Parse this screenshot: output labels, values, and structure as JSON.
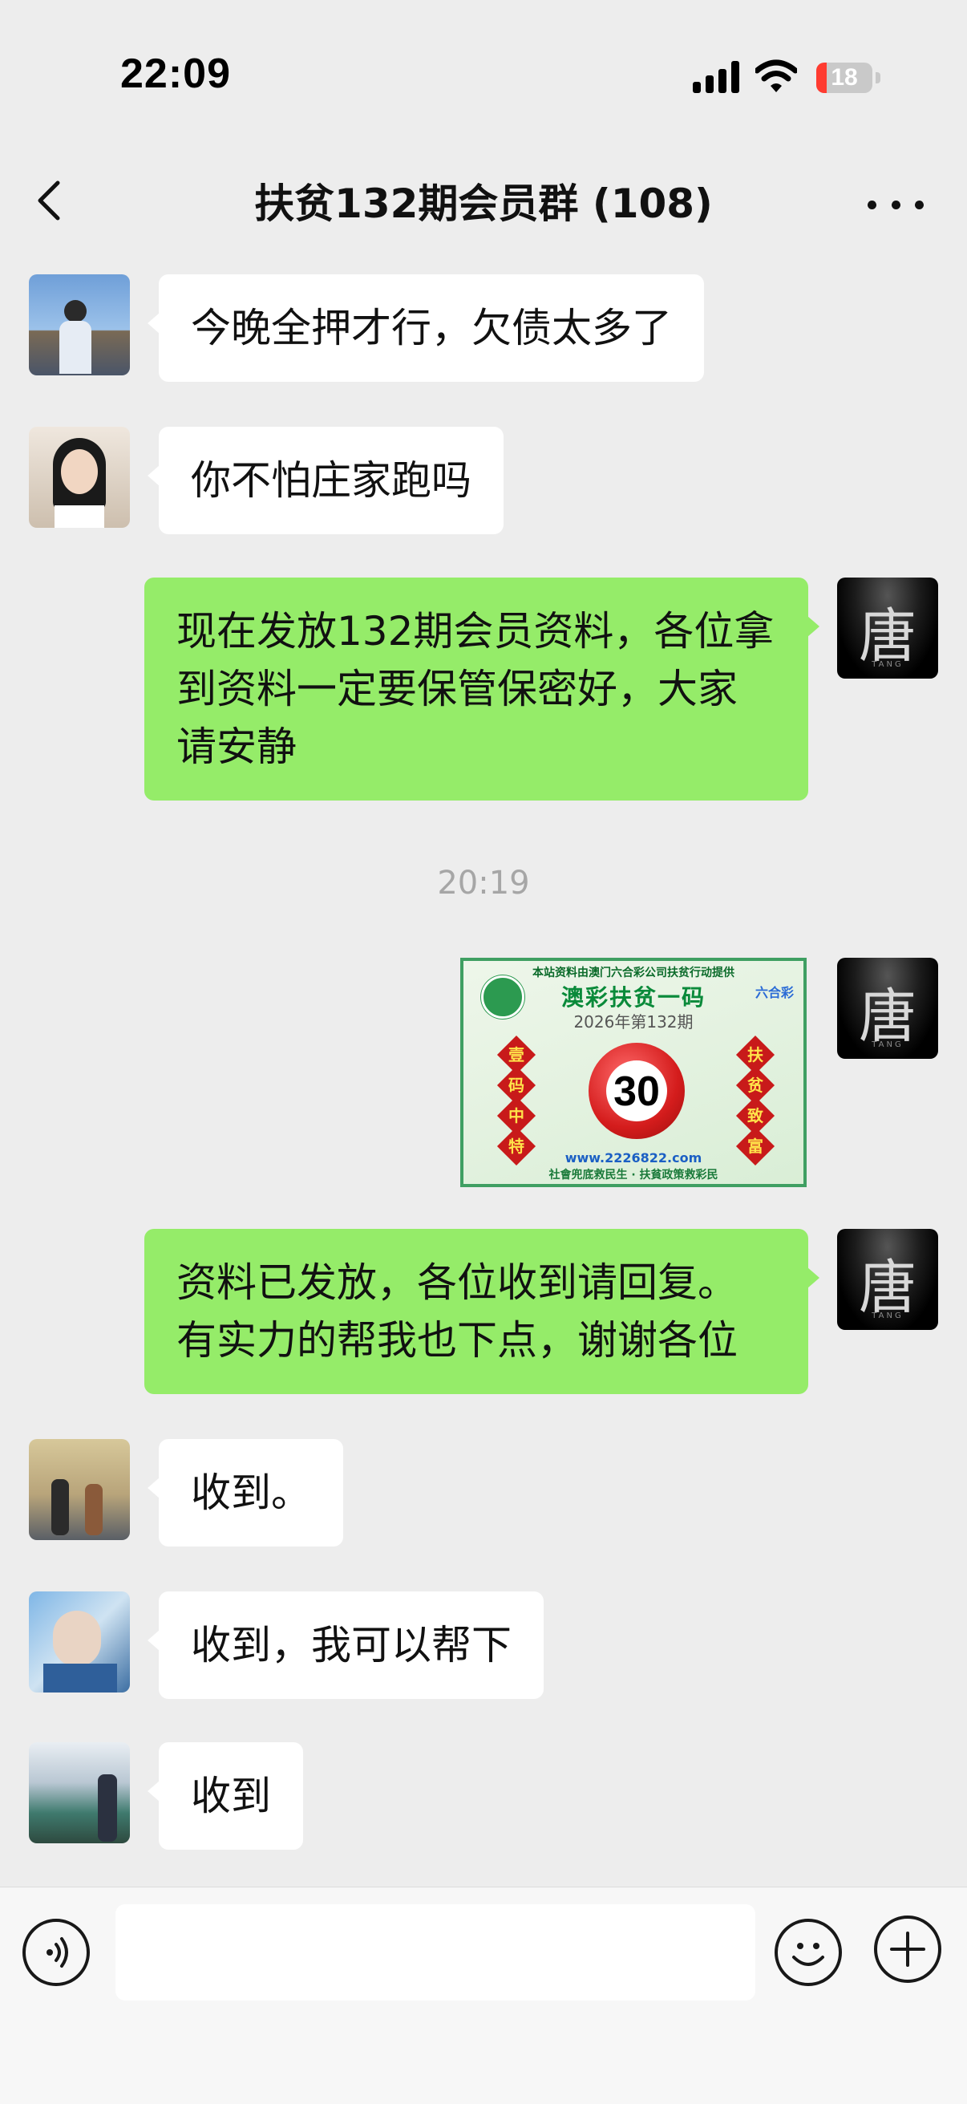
{
  "status_bar": {
    "time": "22:09",
    "battery": "18"
  },
  "header": {
    "title": "扶贫132期会员群 (108)"
  },
  "icons": {
    "back": "chevron-left-icon",
    "more": "more-horizontal-icon",
    "voice": "voice-icon",
    "emoji": "emoji-icon",
    "plus": "plus-icon",
    "signal": "signal-icon",
    "wifi": "wifi-icon"
  },
  "messages": [
    {
      "side": "left",
      "text": "今晚全押才行，欠债太多了"
    },
    {
      "side": "left",
      "text": "你不怕庄家跑吗"
    },
    {
      "side": "right",
      "text": "现在发放132期会员资料，各位拿到资料一定要保管保密好，大家请安静"
    },
    {
      "timestamp": "20:19"
    },
    {
      "side": "right",
      "type": "image"
    },
    {
      "side": "right",
      "text": "资料已发放，各位收到请回复。有实力的帮我也下点，谢谢各位"
    },
    {
      "side": "left",
      "text": "收到。"
    },
    {
      "side": "left",
      "text": "收到，我可以帮下"
    },
    {
      "side": "left",
      "text": "收到"
    }
  ],
  "sender_avatar": {
    "char": "唐",
    "sub": "TANG"
  },
  "image_card": {
    "topline": "本站资料由澳门六合彩公司扶贫行动提供",
    "title": "澳彩扶贫一码",
    "issue": "2026年第132期",
    "logo": "六合彩",
    "left_chars": [
      "壹",
      "码",
      "中",
      "特"
    ],
    "right_chars": [
      "扶",
      "贫",
      "致",
      "富"
    ],
    "number": "30",
    "url": "www.2226822.com",
    "slogan": "社會兜底救民生 · 扶貧政策救彩民"
  },
  "colors": {
    "background": "#ededed",
    "bubble_out": "#95ec69",
    "bubble_in": "#ffffff",
    "battery": "#ff3b30"
  }
}
